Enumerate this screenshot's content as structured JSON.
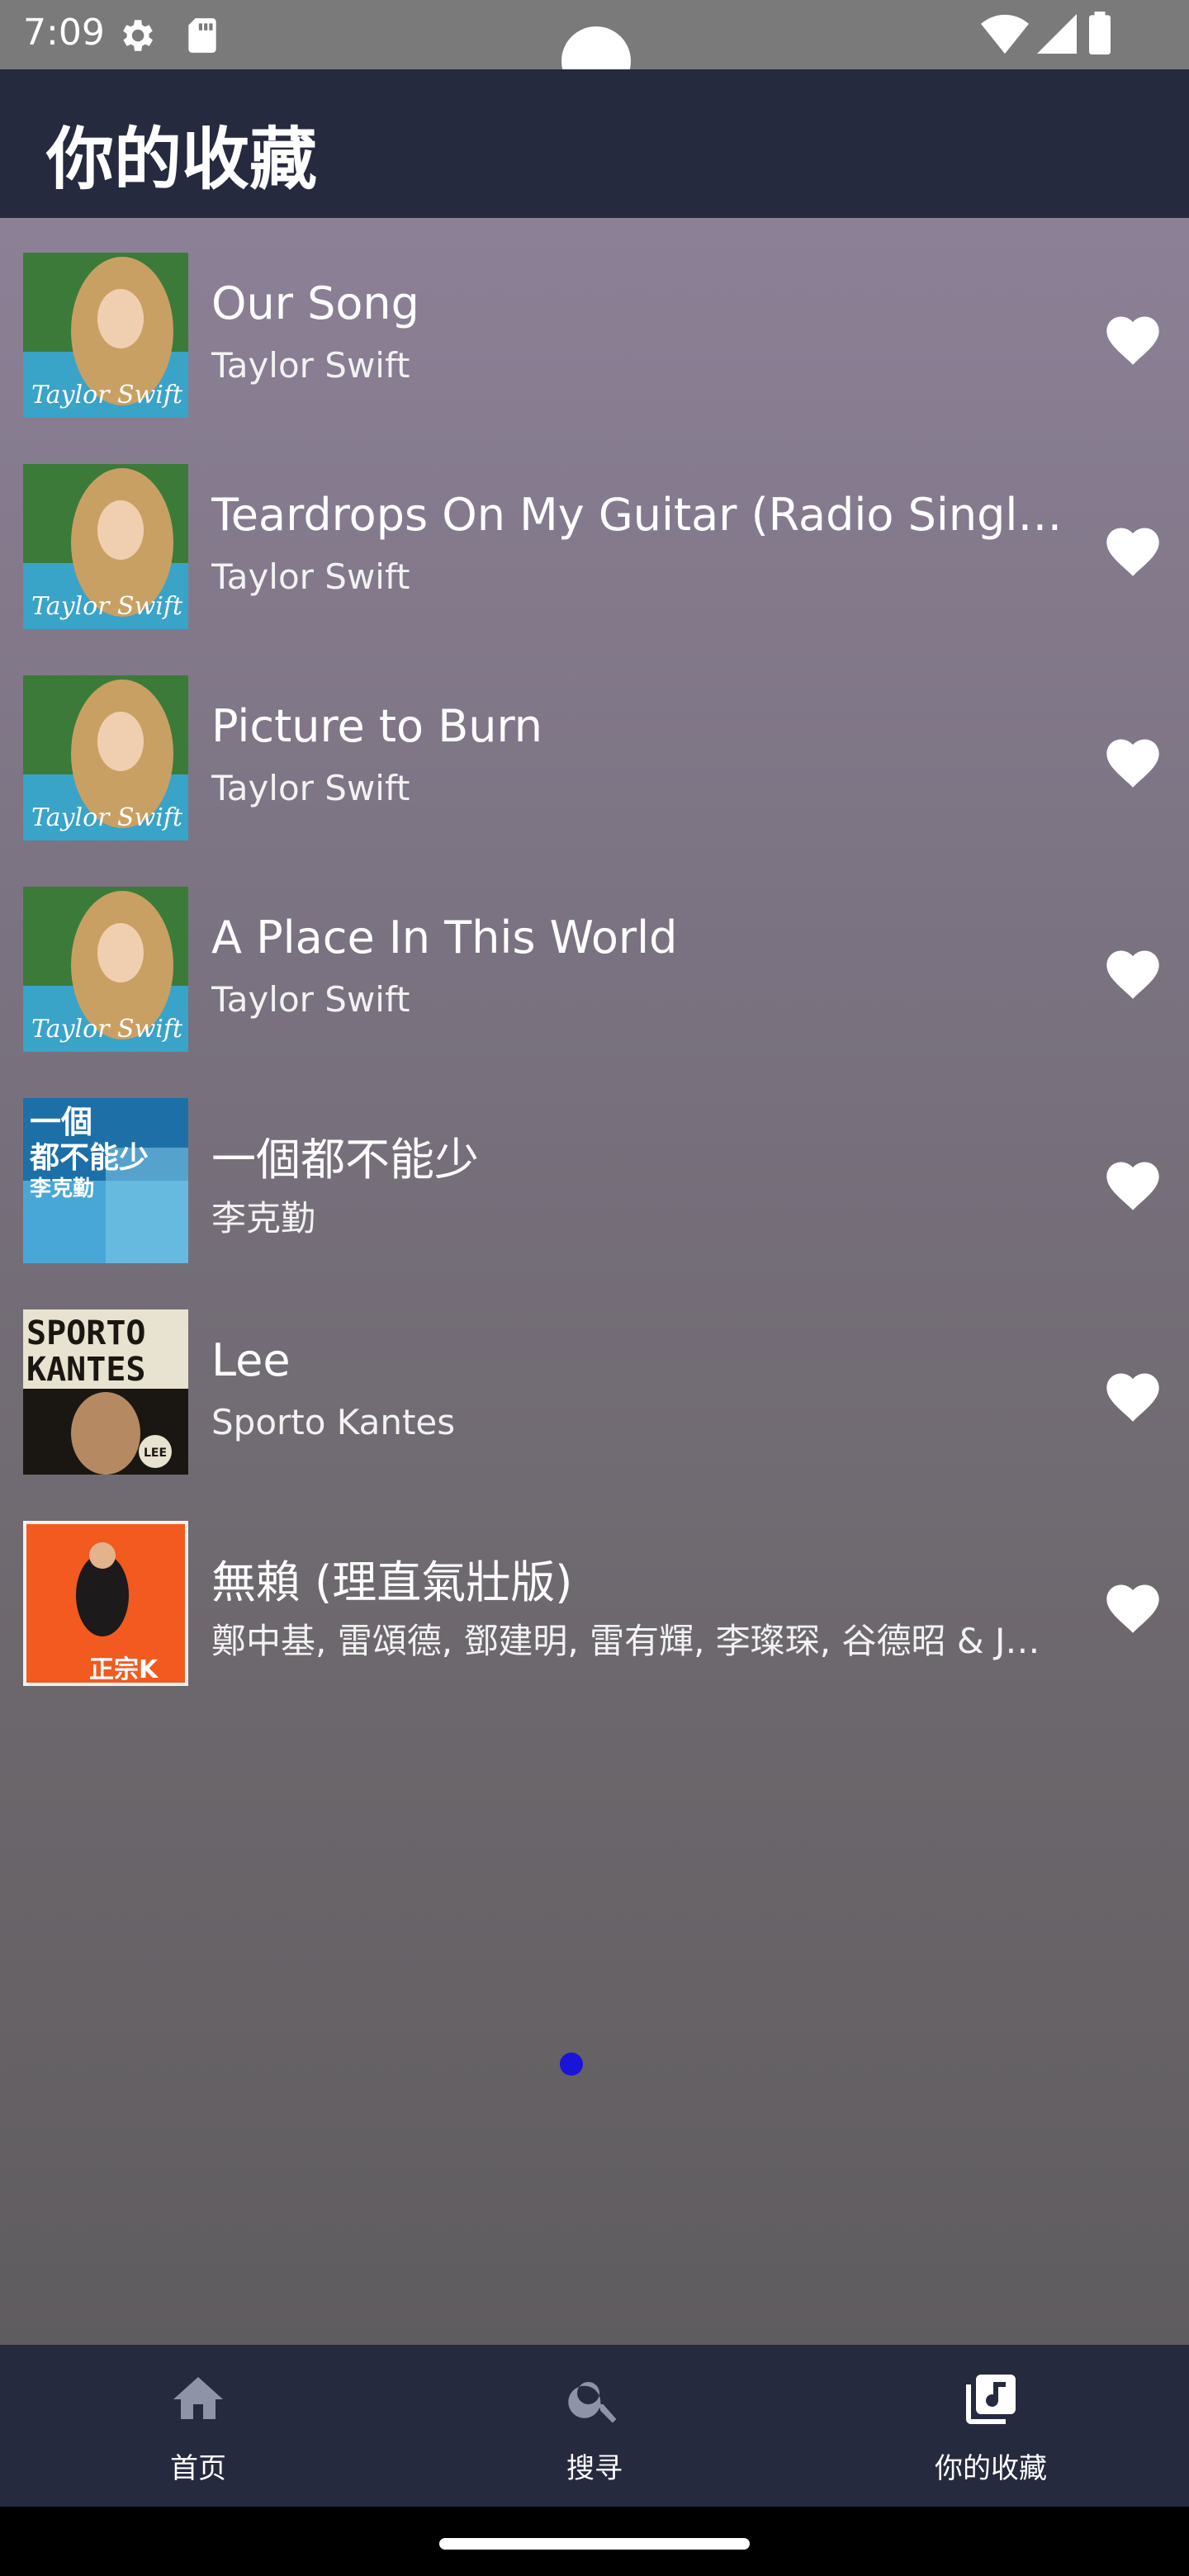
{
  "status_bar": {
    "time": "7:09",
    "icons": [
      "gear-icon",
      "sd-card-icon",
      "wifi-icon",
      "signal-icon",
      "battery-icon"
    ]
  },
  "app_bar": {
    "title": "你的收藏"
  },
  "favorites": [
    {
      "title": "Our Song",
      "artist": "Taylor Swift",
      "cover": "taylor-swift-cover"
    },
    {
      "title": "Teardrops On My Guitar (Radio Single Remix)",
      "artist": "Taylor Swift",
      "cover": "taylor-swift-cover"
    },
    {
      "title": "Picture to Burn",
      "artist": "Taylor Swift",
      "cover": "taylor-swift-cover"
    },
    {
      "title": "A Place In This World",
      "artist": "Taylor Swift",
      "cover": "taylor-swift-cover"
    },
    {
      "title": "一個都不能少",
      "artist": "李克勤",
      "cover": "li-ke-qin-cover"
    },
    {
      "title": "Lee",
      "artist": "Sporto Kantes",
      "cover": "sporto-kantes-cover"
    },
    {
      "title": "無賴 (理直氣壯版)",
      "artist": "鄭中基, 雷頌德, 鄧建明, 雷有輝, 李璨琛, 谷德昭 & Jan Lamb",
      "cover": "zheng-zhong-ji-cover"
    }
  ],
  "cover_text": {
    "li_ke_qin": {
      "line1": "一個",
      "line2": "都不能少",
      "line3": "李克勤"
    },
    "sporto": {
      "line1": "SPORTO",
      "line2": "KANTES",
      "badge": "LEE"
    },
    "zheng": {
      "logo": "正宗K"
    }
  },
  "bottom_nav": [
    {
      "label": "首页",
      "icon": "home-icon"
    },
    {
      "label": "搜寻",
      "icon": "search-icon"
    },
    {
      "label": "你的收藏",
      "icon": "library-music-icon"
    }
  ],
  "colors": {
    "app_bar": "#262a3f",
    "page_dot": "#1a14d8",
    "content_top": "#8c8096",
    "content_bottom": "#5f5c5f"
  }
}
